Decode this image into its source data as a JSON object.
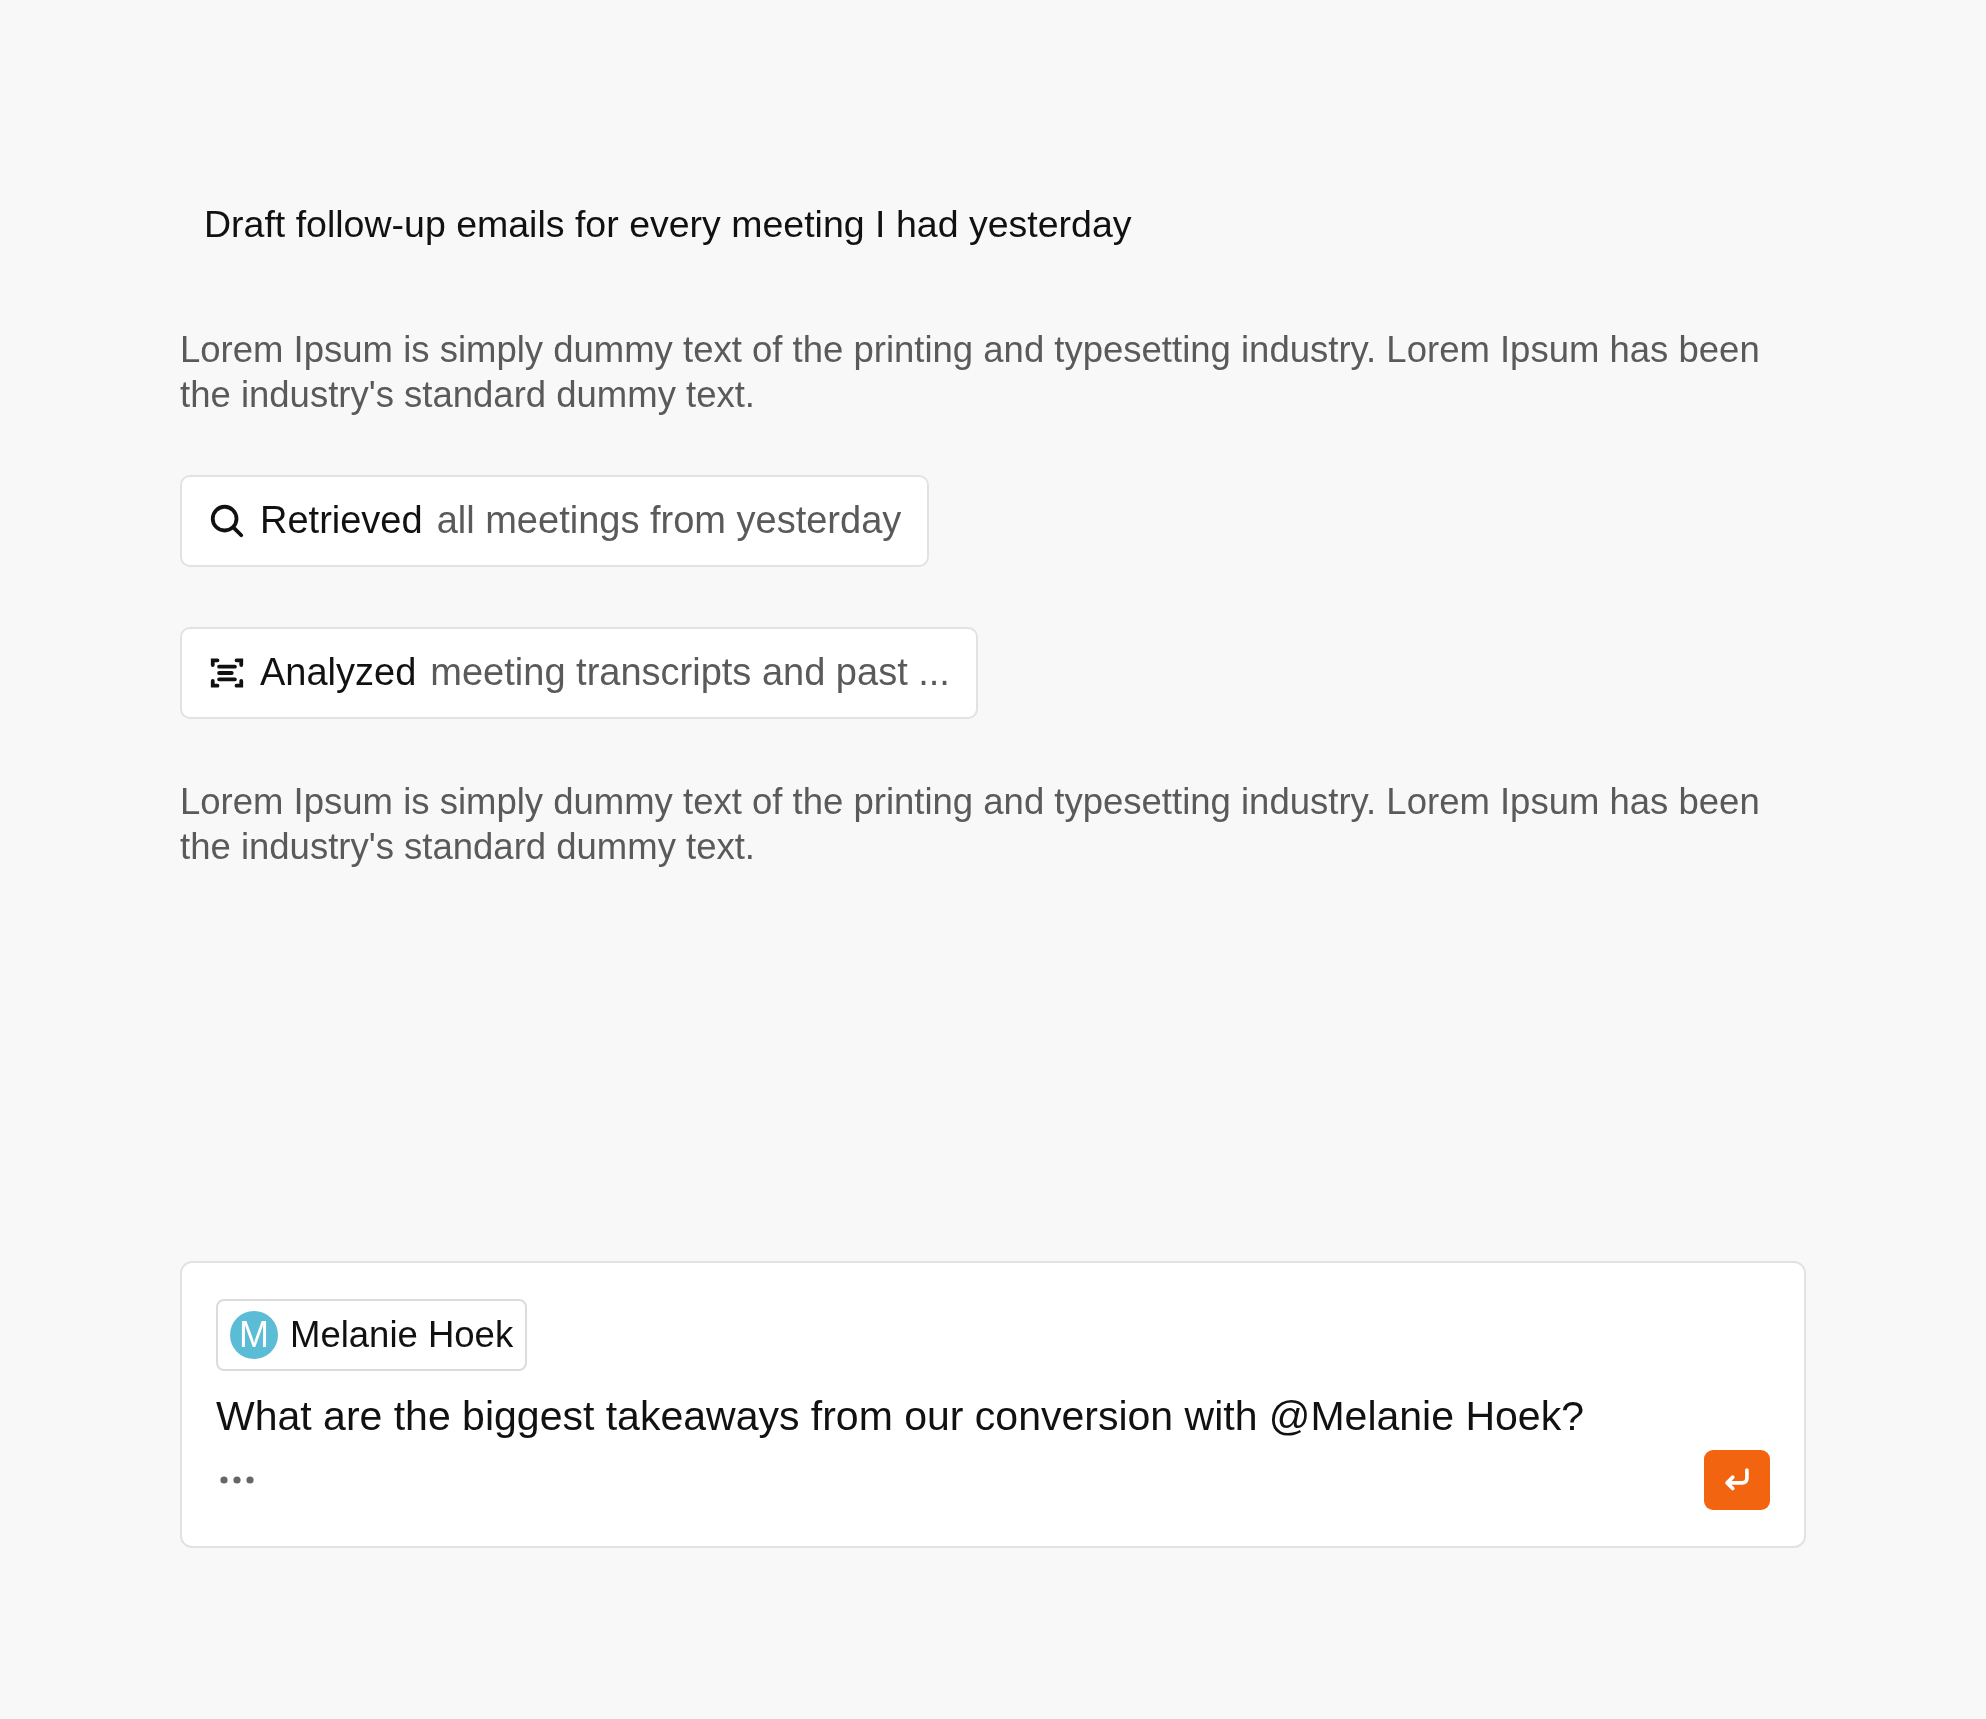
{
  "prompt": "Draft follow-up emails for every meeting I had yesterday",
  "blocks": [
    {
      "kind": "paragraph",
      "text": "Lorem Ipsum is simply dummy text of the printing and typesetting industry. Lorem Ipsum has been the industry's standard dummy text."
    },
    {
      "kind": "search",
      "action": "Retrieved",
      "detail": "all meetings from yesterday"
    },
    {
      "kind": "analysis",
      "action": "Analyzed",
      "detail": "meeting transcripts and past ..."
    },
    {
      "kind": "paragraph",
      "text": "Lorem Ipsum is simply dummy text of the printing and typesetting industry. Lorem Ipsum has been the industry's standard dummy text."
    }
  ],
  "composer": {
    "mention": {
      "initial": "M",
      "name": "Melanie Hoek",
      "color": "#5bbcd6"
    },
    "value": "What are the biggest takeaways from our conversion with @Melanie Hoek?"
  }
}
